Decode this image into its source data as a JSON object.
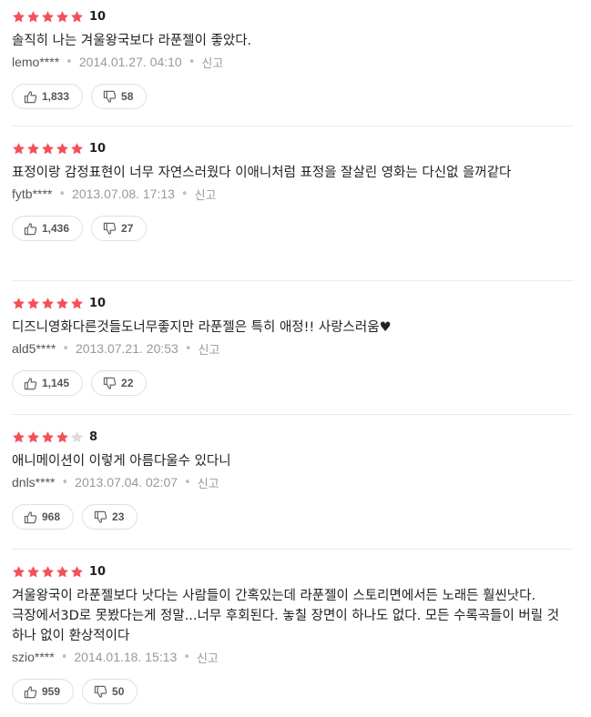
{
  "colors": {
    "star_filled": "#f5505a",
    "star_empty": "#dcdcdc"
  },
  "icons": {
    "star": "star-icon",
    "like": "thumbs-up-icon",
    "dislike": "thumbs-down-icon"
  },
  "reviews": [
    {
      "stars": 5,
      "score": "10",
      "text": "솔직히 나는 겨울왕국보다 라푼젤이 좋았다.",
      "author": "lemo****",
      "date": "2014.01.27. 04:10",
      "report": "신고",
      "likes": "1,833",
      "dislikes": "58"
    },
    {
      "stars": 5,
      "score": "10",
      "text": "표정이랑 감정표현이 너무 자연스러웠다 이애니처럼 표정을 잘살린 영화는 다신없 을꺼같다",
      "author": "fytb****",
      "date": "2013.07.08. 17:13",
      "report": "신고",
      "likes": "1,436",
      "dislikes": "27"
    },
    {
      "stars": 5,
      "score": "10",
      "text": "디즈니영화다른것들도너무좋지만 라푼젤은 특히 애정!! 사랑스러움♥",
      "author": "ald5****",
      "date": "2013.07.21. 20:53",
      "report": "신고",
      "likes": "1,145",
      "dislikes": "22"
    },
    {
      "stars": 4,
      "score": "8",
      "text": "애니메이션이 이렇게 아름다울수 있다니",
      "author": "dnls****",
      "date": "2013.07.04. 02:07",
      "report": "신고",
      "likes": "968",
      "dislikes": "23"
    },
    {
      "stars": 5,
      "score": "10",
      "text": "겨울왕국이 라푼젤보다 낫다는 사람들이 간혹있는데 라푼젤이 스토리면에서든 노래든 훨씬낫다. 극장에서3D로 못봤다는게 정말...너무 후회된다. 놓칠 장면이 하나도 없다. 모든 수록곡들이 버릴 것 하나 없이 환상적이다",
      "author": "szio****",
      "date": "2014.01.18. 15:13",
      "report": "신고",
      "likes": "959",
      "dislikes": "50"
    }
  ]
}
